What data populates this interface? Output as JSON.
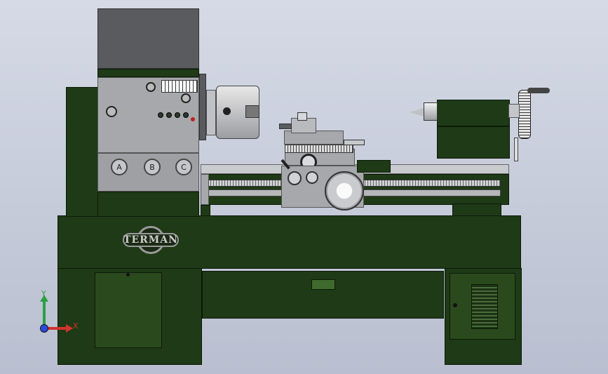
{
  "headstock": {
    "buttons": [
      {
        "label": "A"
      },
      {
        "label": "B"
      },
      {
        "label": "C"
      }
    ]
  },
  "bed": {
    "brand_label": "TERMAN"
  },
  "triad": {
    "x_label": "X",
    "y_label": "Y"
  },
  "colors": {
    "machine_green": "#1e3a16",
    "panel_grey": "#a6a8ac",
    "background": "#c9cedb"
  }
}
